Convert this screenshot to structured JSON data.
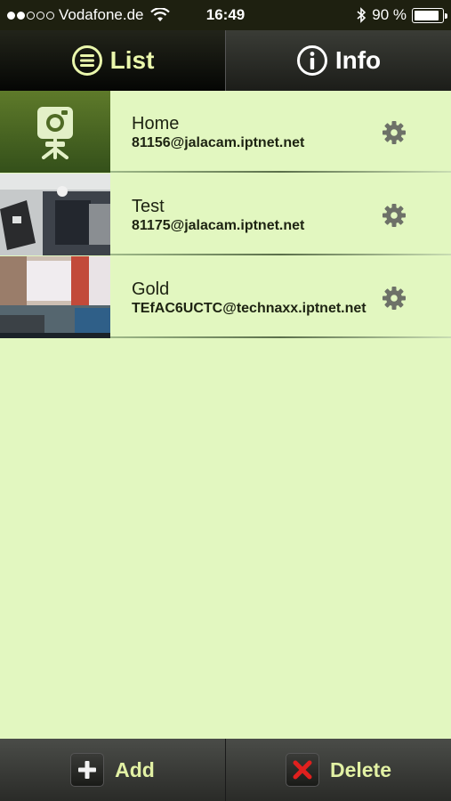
{
  "status_bar": {
    "signal_dots_filled": 2,
    "signal_dots_total": 5,
    "carrier": "Vodafone.de",
    "time": "16:49",
    "battery_text": "90 %",
    "battery_level": 0.9
  },
  "tabs": [
    {
      "label": "List",
      "icon": "list-icon",
      "active": true
    },
    {
      "label": "Info",
      "icon": "info-icon",
      "active": false
    }
  ],
  "cameras": [
    {
      "name": "Home",
      "address": "81156@jalacam.iptnet.net",
      "thumbnail": "camera-placeholder-icon"
    },
    {
      "name": "Test",
      "address": "81175@jalacam.iptnet.net",
      "thumbnail": "camera-snapshot"
    },
    {
      "name": "Gold",
      "address": "TEfAC6UCTC@technaxx.iptnet.net",
      "thumbnail": "camera-snapshot"
    }
  ],
  "bottom_bar": {
    "add_label": "Add",
    "delete_label": "Delete"
  },
  "colors": {
    "background": "#e2f7c0",
    "accent_text": "#e2f1a4",
    "delete_red": "#e0201e"
  }
}
